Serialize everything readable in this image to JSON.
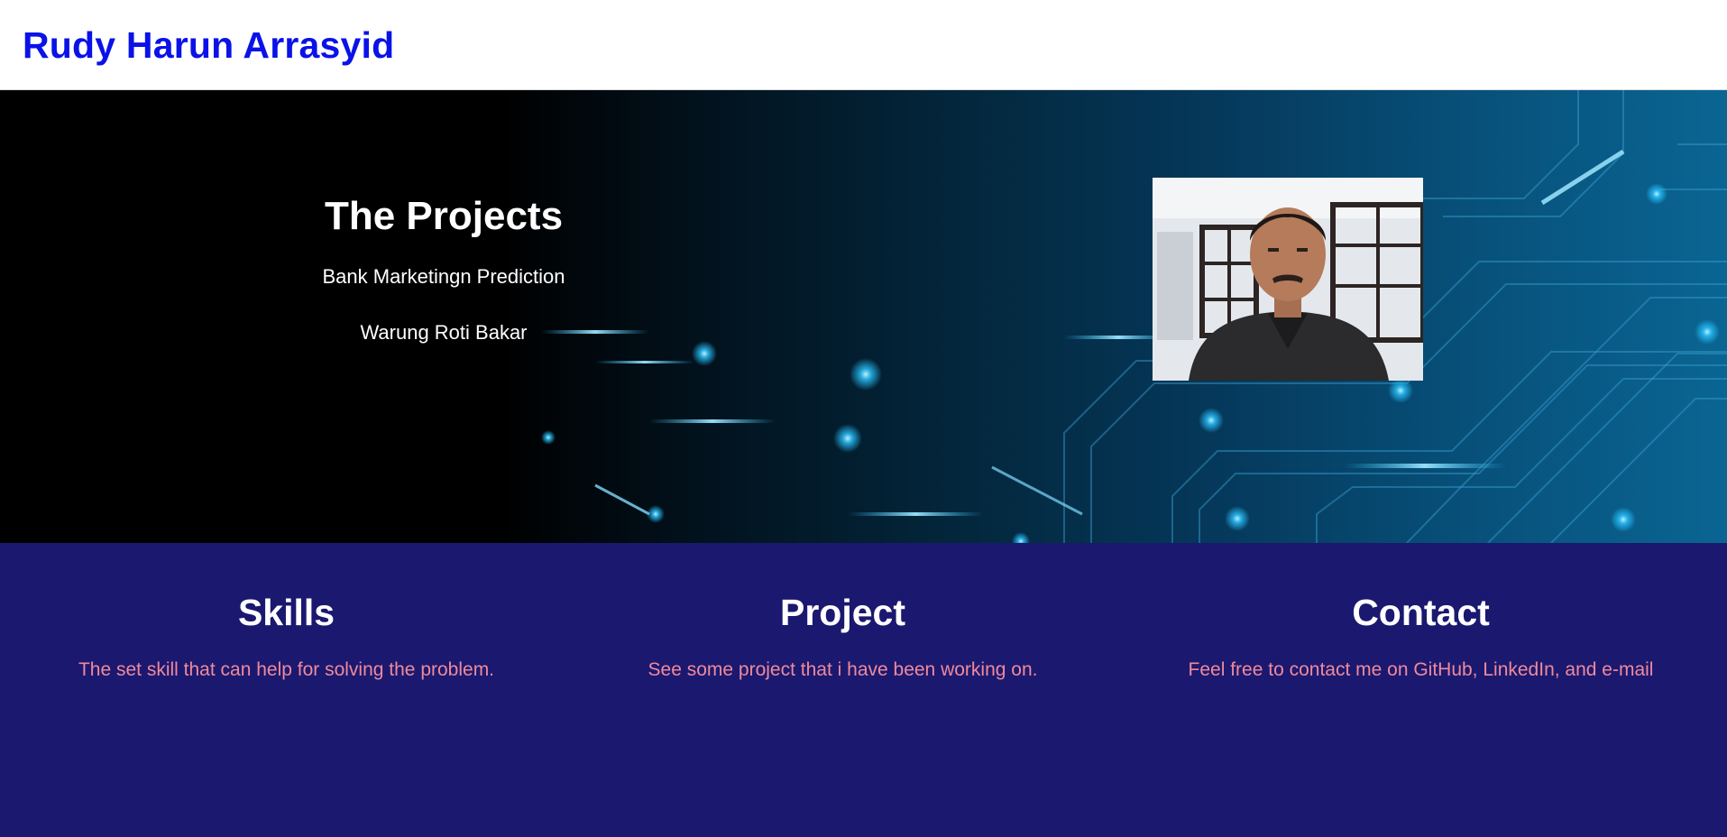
{
  "header": {
    "title": "Rudy Harun Arrasyid"
  },
  "hero": {
    "heading": "The Projects",
    "projects": [
      "Bank Marketingn Prediction",
      "Warung Roti Bakar"
    ],
    "portrait_icon": "person-photo-icon"
  },
  "sections": {
    "skills": {
      "title": "Skills",
      "description": "The set skill that can help for solving the problem."
    },
    "project": {
      "title": "Project",
      "description": "See some project that i have been working on."
    },
    "contact": {
      "title": "Contact",
      "description": "Feel free to contact me on GitHub, LinkedIn, and e-mail"
    }
  },
  "colors": {
    "title_blue": "#0a12e8",
    "footer_navy": "#1b1870",
    "description_pink": "#ef8a9a",
    "circuit_glow": "#29c4ff"
  }
}
